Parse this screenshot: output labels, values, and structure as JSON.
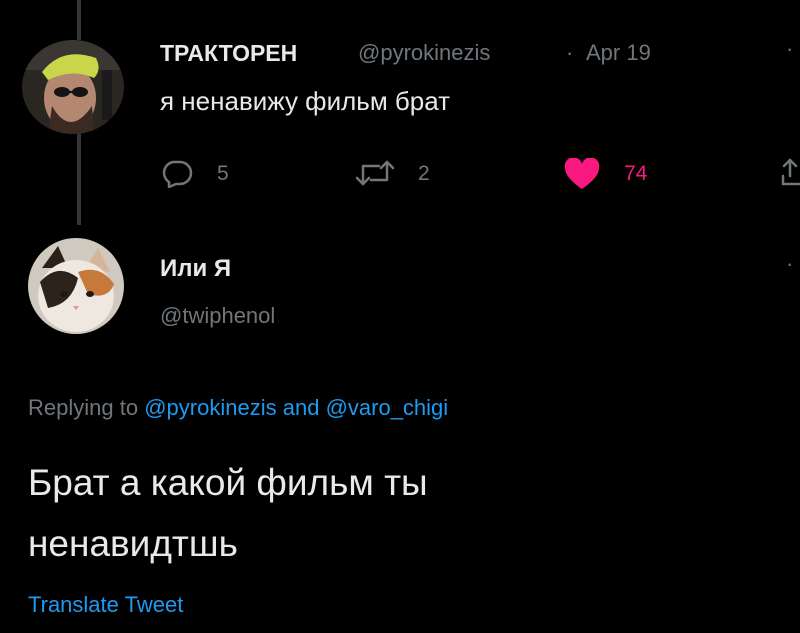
{
  "tweet": {
    "display_name": "ТРАКТОРЕН",
    "handle": "@pyrokinezis",
    "separator": "·",
    "date": "Apr 19",
    "text": "я ненавижу фильм брат",
    "replies": "5",
    "retweets": "2",
    "likes": "74",
    "liked": true
  },
  "reply": {
    "display_name": "Или Я",
    "handle": "@twiphenol",
    "replying_prefix": "Replying to",
    "mention_1": "@pyrokinezis",
    "conjunction": "and",
    "mention_2": "@varo_chigi",
    "text_line1": "Брат а какой фильм ты",
    "text_line2": "ненавидтшь",
    "translate": "Translate Tweet"
  },
  "colors": {
    "background": "#000000",
    "text": "#e7e9ea",
    "muted": "#71767b",
    "link": "#1d9bf0",
    "like": "#f91880"
  }
}
